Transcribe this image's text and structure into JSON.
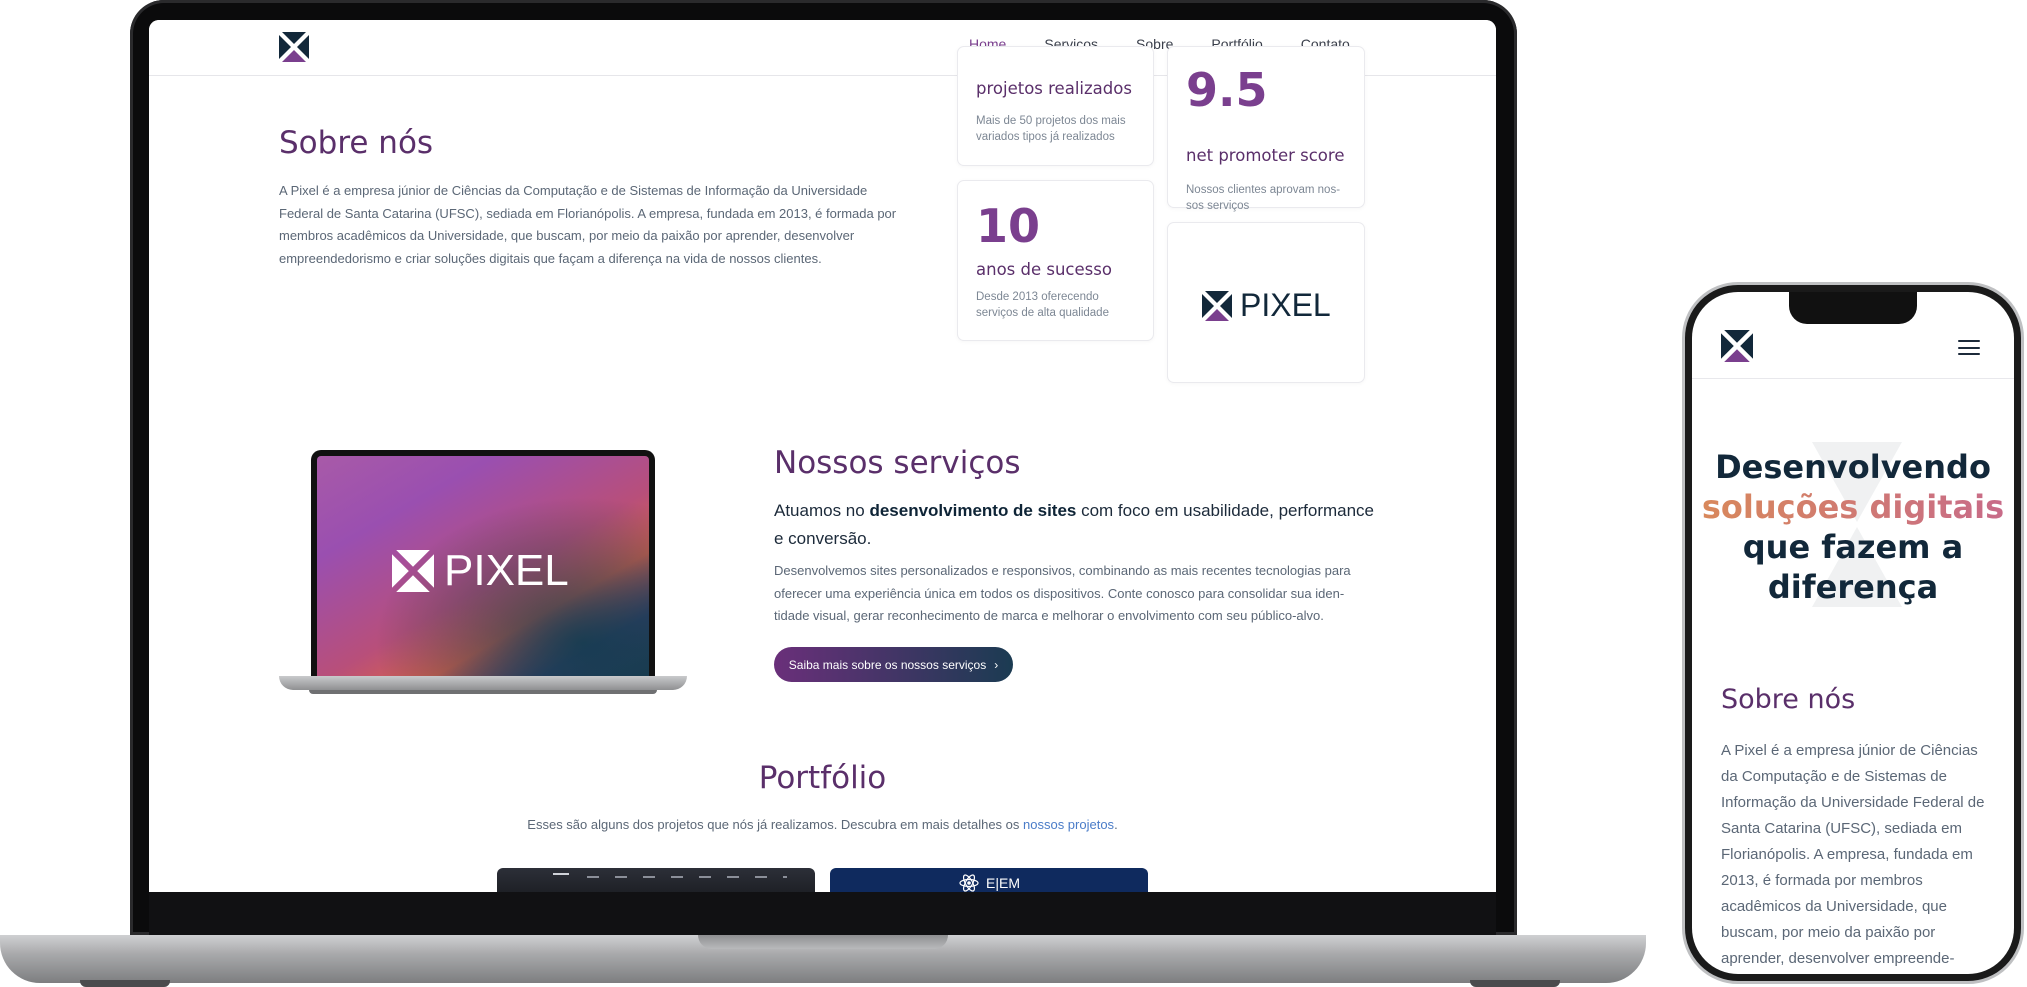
{
  "laptop": {
    "nav": {
      "links": [
        {
          "label": "Home",
          "active": true
        },
        {
          "label": "Serviços"
        },
        {
          "label": "Sobre"
        },
        {
          "label": "Portfólio"
        },
        {
          "label": "Contato"
        }
      ]
    },
    "sobre": {
      "title": "Sobre nós",
      "text": "A Pixel é a empresa júnior de Ciências da Computação e de Sistemas de Informação da Universidade Federal de Santa Catarina (UFSC), sediada em Florianópolis. A empresa, fundada em 2013, é formada por membros acadêmicos da Universidade, que buscam, por meio da paixão por aprender, desenvolver empreendedorismo e criar soluções digitais que façam a diferença na vida de nossos clientes."
    },
    "stats": [
      {
        "label": "projetos realizados",
        "desc": "Mais de 50 projetos dos mais variados tipos já realizados"
      },
      {
        "number": "9.5",
        "label": "net promoter score",
        "desc": "Nossos clientes aprovam nos-sos serviços"
      },
      {
        "number": "10",
        "label": "anos de sucesso",
        "desc": "Desde 2013 oferecendo serviços de alta qualidade"
      }
    ],
    "logo_card": {
      "wordmark": "PIXEL"
    },
    "mock_laptop": {
      "wordmark": "PIXEL"
    },
    "servicos": {
      "title": "Nossos serviços",
      "lead_prefix": "Atuamos no ",
      "lead_bold": "desenvolvimento de sites",
      "lead_suffix": " com foco em usabilidade, performance e conversão.",
      "text": "Desenvolvemos sites personalizados e responsivos, combinando as mais recentes tecnologias para oferecer uma experiência única em todos os dispositivos. Conte conosco para consolidar sua iden-tidade visual, gerar reconhecimento de marca e melhorar o envolvimento com seu público-alvo.",
      "button_label": "Saiba mais sobre os nossos serviços",
      "button_chevron": "›"
    },
    "portfolio": {
      "title": "Portfólio",
      "subtitle_prefix": "Esses são alguns dos projetos que nós já realizamos. Descubra em mais detalhes os ",
      "subtitle_link": "nossos projetos",
      "subtitle_suffix": ".",
      "card2_label": "E|EM"
    }
  },
  "phone": {
    "hero": {
      "line1": "Desenvolvendo",
      "line2": "soluções digitais",
      "line3": "que fazem a",
      "line4": "diferença"
    },
    "sobre": {
      "title": "Sobre nós",
      "text": "A Pixel é a empresa júnior de Ciências da Computação e de Sistemas de Informação da Universidade Federal de Santa Catarina (UFSC), sediada em Florianópolis. A empresa, fundada em 2013, é formada por membros acadêmicos da Universidade, que buscam, por meio da paixão por aprender, desenvolver empreende-"
    }
  },
  "colors": {
    "brand_purple": "#5a2f6a",
    "brand_dark": "#12283a",
    "accent": "#7a3f8e",
    "link": "#4a7cc8"
  },
  "icons": [
    "pixel-logo-icon",
    "menu-icon",
    "chevron-right-icon",
    "atom-icon"
  ]
}
